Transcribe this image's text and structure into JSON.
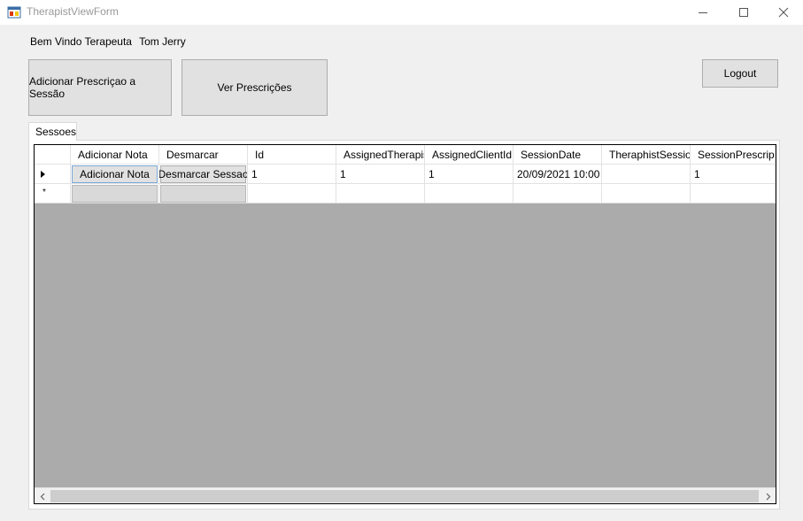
{
  "window": {
    "title": "TherapistViewForm"
  },
  "welcome": {
    "greeting": "Bem Vindo Terapeuta",
    "user_name": "Tom Jerry"
  },
  "buttons": {
    "add_prescription": "Adicionar Prescriçao a Sessão",
    "view_prescriptions": "Ver Prescrições",
    "logout": "Logout"
  },
  "tabs": [
    {
      "label": "Sessoes"
    }
  ],
  "grid": {
    "columns": [
      "Adicionar Nota",
      "Desmarcar",
      "Id",
      "AssignedTherapistId",
      "AssignedClientId",
      "SessionDate",
      "TheraphistSessionNote",
      "SessionPrescriptionId"
    ],
    "rows": [
      {
        "add_note_button": "Adicionar Nota",
        "cancel_button": "Desmarcar Sessao",
        "id": "1",
        "assigned_therapist_id": "1",
        "assigned_client_id": "1",
        "session_date": "20/09/2021 10:00",
        "therapist_session_note": "",
        "session_prescription_id": "1"
      }
    ]
  },
  "colors": {
    "grid_background": "#ababab",
    "window_background": "#f0f0f0",
    "button_face": "#e1e1e1"
  }
}
